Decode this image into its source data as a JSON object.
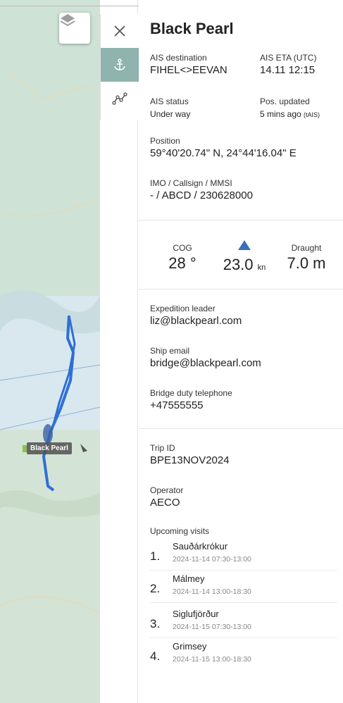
{
  "vessel": {
    "name": "Black Pearl",
    "map_label": "Black Pearl"
  },
  "ais": {
    "destination_label": "AIS destination",
    "destination": "FIHEL<>EEVAN",
    "eta_label": "AIS ETA (UTC)",
    "eta": "14.11 12:15",
    "status_label": "AIS status",
    "status": "Under way",
    "updated_label": "Pos. updated",
    "updated": "5 mins ago",
    "updated_source": "(tAIS)"
  },
  "position": {
    "label": "Position",
    "value": "59°40'20.74\" N, 24°44'16.04\" E"
  },
  "ids": {
    "label": "IMO / Callsign / MMSI",
    "value": "- / ABCD / 230628000"
  },
  "nav": {
    "cog_label": "COG",
    "cog_value": "28 °",
    "speed_value": "23.0",
    "speed_unit": "kn",
    "draught_label": "Draught",
    "draught_value": "7.0 m"
  },
  "contacts": {
    "leader_label": "Expedition leader",
    "leader": "liz@blackpearl.com",
    "email_label": "Ship email",
    "email": "bridge@blackpearl.com",
    "phone_label": "Bridge duty telephone",
    "phone": "+47555555"
  },
  "trip": {
    "id_label": "Trip ID",
    "id": "BPE13NOV2024",
    "operator_label": "Operator",
    "operator": "AECO",
    "visits_label": "Upcoming visits",
    "visits": [
      {
        "num": "1.",
        "place": "Sauðárkrókur",
        "time": "2024-11-14 07:30-13:00"
      },
      {
        "num": "2.",
        "place": "Málmey",
        "time": "2024-11-14 13:00-18:30"
      },
      {
        "num": "3.",
        "place": "Siglufjörður",
        "time": "2024-11-15 07:30-13:00"
      },
      {
        "num": "4.",
        "place": "Grimsey",
        "time": "2024-11-15 13:00-18:30"
      }
    ]
  },
  "icons": {
    "close": "close-icon",
    "anchor": "anchor-icon",
    "route": "route-icon",
    "layers": "layers-icon",
    "heading": "heading-triangle-icon"
  },
  "colors": {
    "track": "#2f6fd6",
    "active_tool": "#8fb3ad",
    "heading": "#3d6fb8"
  }
}
